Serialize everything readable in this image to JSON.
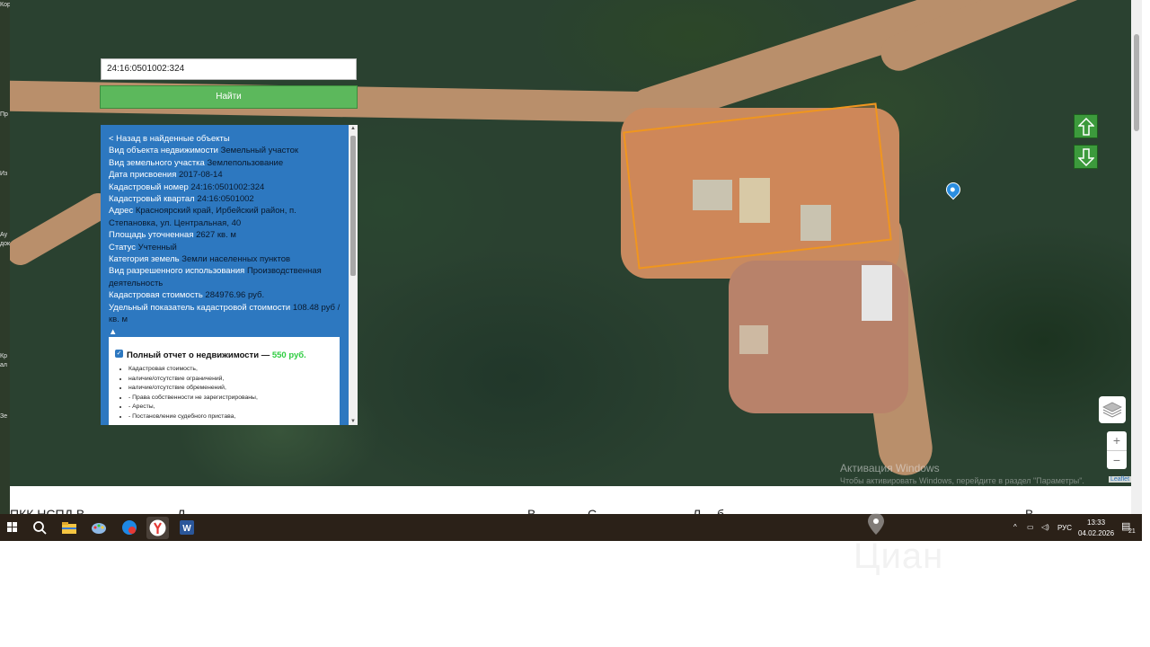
{
  "search": {
    "value": "24:16:0501002:324",
    "button_label": "Найти"
  },
  "panel": {
    "back_link": "< Назад в найденные объекты",
    "rows": [
      {
        "label": "Вид объекта недвижимости",
        "value": "Земельный участок"
      },
      {
        "label": "Вид земельного участка",
        "value": "Землепользование"
      },
      {
        "label": "Дата присвоения",
        "value": "2017-08-14"
      },
      {
        "label": "Кадастровый номер",
        "value": "24:16:0501002:324"
      },
      {
        "label": "Кадастровый квартал",
        "value": "24:16:0501002"
      },
      {
        "label": "Адрес",
        "value": "Красноярский край, Ирбейский район, п. Степановка, ул. Центральная, 40"
      },
      {
        "label": "Площадь уточненная",
        "value": "2627 кв. м"
      },
      {
        "label": "Статус",
        "value": "Учтенный"
      },
      {
        "label": "Категория земель",
        "value": "Земли населенных пунктов"
      },
      {
        "label": "Вид разрешенного использования",
        "value": "Производственная деятельность"
      },
      {
        "label": "Кадастровая стоимость",
        "value": "284976.96 руб."
      },
      {
        "label": "Удельный показатель кадастровой стоимости",
        "value": "108.48 руб / кв. м"
      }
    ],
    "collapse_glyph": "▲",
    "report": {
      "title": "Полный отчет о недвижимости —",
      "price": "550 руб.",
      "items": [
        "Кадастровая стоимость,",
        "наличие/отсутствие ограничений,",
        "наличие/отсутствие обременений,",
        "- Права собственности не зарегистрированы,",
        "- Аресты,",
        "- Постановление судебного пристава,"
      ]
    }
  },
  "map": {
    "windows_watermark": "Активация Windows",
    "windows_watermark_sub": "Чтобы активировать Windows, перейдите в раздел \"Параметры\".",
    "attribution": "Leaflet",
    "zoom_in": "+",
    "zoom_out": "−",
    "parcel_color": "#f0961e"
  },
  "below_strip": {
    "texts": [
      "ПКК НСПД В",
      "Д",
      "В",
      "С",
      "Л",
      "б",
      "В"
    ]
  },
  "taskbar": {
    "language": "РУС",
    "time": "13:33",
    "date": "04.02.2026",
    "notification_count": "21"
  },
  "background_brand": "Циан",
  "left_strip_labels": [
    "Кор",
    "Пр",
    "Из",
    "Ау",
    "док",
    "Кр",
    "ал",
    "Зе"
  ]
}
